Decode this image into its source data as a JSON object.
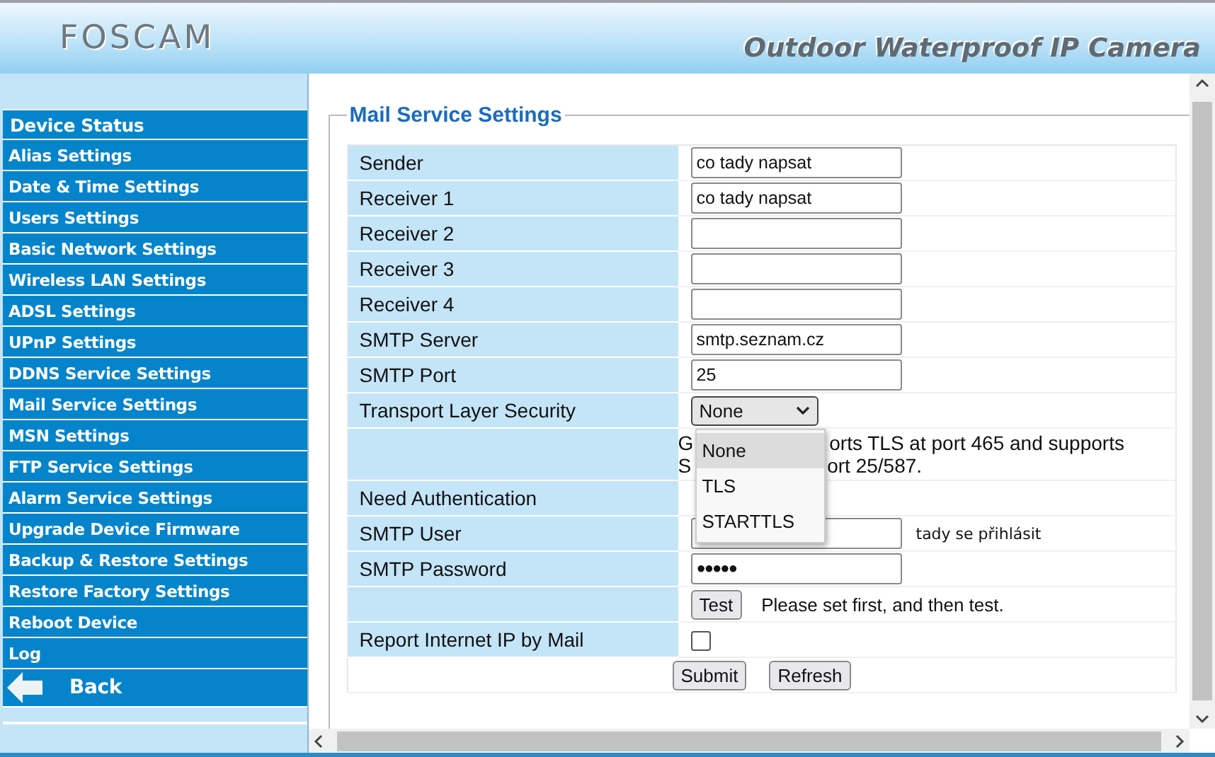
{
  "header": {
    "logo": "FOSCAM",
    "tagline": "Outdoor Waterproof IP Camera"
  },
  "sidebar": {
    "items": [
      {
        "label": "Device Status",
        "kind": "heading"
      },
      {
        "label": "Alias Settings",
        "kind": "link"
      },
      {
        "label": "Date & Time Settings",
        "kind": "link"
      },
      {
        "label": "Users Settings",
        "kind": "link"
      },
      {
        "label": "Basic Network Settings",
        "kind": "link"
      },
      {
        "label": "Wireless LAN Settings",
        "kind": "link"
      },
      {
        "label": "ADSL Settings",
        "kind": "link"
      },
      {
        "label": "UPnP Settings",
        "kind": "link"
      },
      {
        "label": "DDNS Service Settings",
        "kind": "link"
      },
      {
        "label": "Mail Service Settings",
        "kind": "link"
      },
      {
        "label": "MSN Settings",
        "kind": "link"
      },
      {
        "label": "FTP Service Settings",
        "kind": "link"
      },
      {
        "label": "Alarm Service Settings",
        "kind": "link"
      },
      {
        "label": "Upgrade Device Firmware",
        "kind": "link"
      },
      {
        "label": "Backup & Restore Settings",
        "kind": "link"
      },
      {
        "label": "Restore Factory Settings",
        "kind": "link"
      },
      {
        "label": "Reboot Device",
        "kind": "link"
      },
      {
        "label": "Log",
        "kind": "link"
      },
      {
        "label": "Back",
        "kind": "back"
      }
    ]
  },
  "form": {
    "title": "Mail Service Settings",
    "rows": [
      {
        "kind": "text",
        "label": "Sender",
        "value": "co tady napsat"
      },
      {
        "kind": "text",
        "label": "Receiver 1",
        "value": "co tady napsat"
      },
      {
        "kind": "text",
        "label": "Receiver 2"
      },
      {
        "kind": "text",
        "label": "Receiver 3"
      },
      {
        "kind": "text",
        "label": "Receiver 4"
      },
      {
        "kind": "text",
        "label": "SMTP Server",
        "value": "smtp.seznam.cz"
      },
      {
        "kind": "text",
        "label": "SMTP Port",
        "value": "25"
      },
      {
        "kind": "select",
        "label": "Transport Layer Security",
        "value": "None",
        "expanded": true,
        "options": [
          {
            "label": "None",
            "selected": true
          },
          {
            "label": "TLS",
            "selected": false
          },
          {
            "label": "STARTTLS",
            "selected": false
          }
        ]
      },
      {
        "kind": "note",
        "lines": [
          {
            "lead": "G",
            "rest": "orts TLS at port 465 and supports"
          },
          {
            "lead": "S",
            "rest": "ort 25/587."
          }
        ]
      },
      {
        "kind": "empty",
        "label": "Need Authentication"
      },
      {
        "kind": "text",
        "label": "SMTP User",
        "hint": "tady se přihlásit"
      },
      {
        "kind": "password",
        "label": "SMTP Password",
        "value": "●●●●●"
      },
      {
        "kind": "test",
        "button": "Test",
        "hint": "Please set first, and then test."
      },
      {
        "kind": "checkbox",
        "label": "Report Internet IP by Mail",
        "checked": false
      }
    ],
    "buttons": [
      "Submit",
      "Refresh"
    ]
  }
}
